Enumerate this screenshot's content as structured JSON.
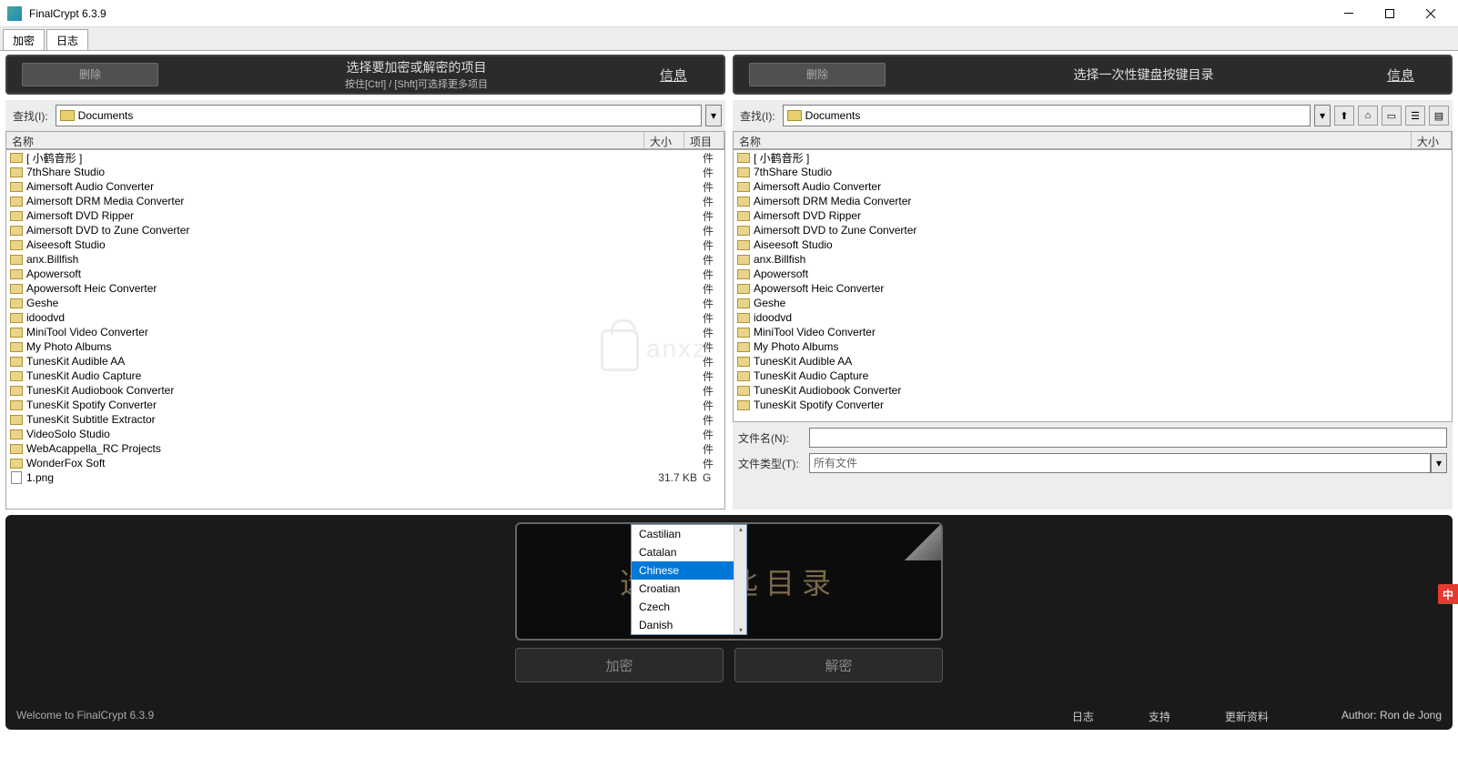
{
  "window": {
    "title": "FinalCrypt 6.3.9"
  },
  "tabs": {
    "t1": "加密",
    "t2": "日志"
  },
  "panelLeft": {
    "delete": "删除",
    "title": "选择要加密或解密的项目",
    "sub": "按住[Ctrl] / [Shft]可选择更多项目",
    "info": "信息"
  },
  "panelRight": {
    "delete": "删除",
    "title": "选择一次性键盘按键目录",
    "info": "信息"
  },
  "lookup": {
    "label": "查找(I):",
    "value": "Documents"
  },
  "cols": {
    "name": "名称",
    "size": "大小",
    "type": "项目类"
  },
  "filesLeft": [
    {
      "n": "[ 小鹤音形 ]",
      "t": "件",
      "f": 1
    },
    {
      "n": "7thShare Studio",
      "t": "件",
      "f": 1
    },
    {
      "n": "Aimersoft Audio Converter",
      "t": "件",
      "f": 1
    },
    {
      "n": "Aimersoft DRM Media Converter",
      "t": "件",
      "f": 1
    },
    {
      "n": "Aimersoft DVD Ripper",
      "t": "件",
      "f": 1
    },
    {
      "n": "Aimersoft DVD to Zune Converter",
      "t": "件",
      "f": 1
    },
    {
      "n": "Aiseesoft Studio",
      "t": "件",
      "f": 1
    },
    {
      "n": "anx.Billfish",
      "t": "件",
      "f": 1
    },
    {
      "n": "Apowersoft",
      "t": "件",
      "f": 1
    },
    {
      "n": "Apowersoft Heic Converter",
      "t": "件",
      "f": 1
    },
    {
      "n": "Geshe",
      "t": "件",
      "f": 1
    },
    {
      "n": "idoodvd",
      "t": "件",
      "f": 1
    },
    {
      "n": "MiniTool Video Converter",
      "t": "件",
      "f": 1
    },
    {
      "n": "My Photo Albums",
      "t": "件",
      "f": 1
    },
    {
      "n": "TunesKit Audible AA",
      "t": "件",
      "f": 1
    },
    {
      "n": "TunesKit Audio Capture",
      "t": "件",
      "f": 1
    },
    {
      "n": "TunesKit Audiobook Converter",
      "t": "件",
      "f": 1
    },
    {
      "n": "TunesKit Spotify Converter",
      "t": "件",
      "f": 1
    },
    {
      "n": "TunesKit Subtitle Extractor",
      "t": "件",
      "f": 1
    },
    {
      "n": "VideoSolo Studio",
      "t": "件",
      "f": 1
    },
    {
      "n": "WebAcappella_RC Projects",
      "t": "件",
      "f": 1
    },
    {
      "n": "WonderFox Soft",
      "t": "件",
      "f": 1
    },
    {
      "n": "1.png",
      "s": "31.7 KB",
      "t": "G",
      "f": 0
    }
  ],
  "filesRight": [
    {
      "n": "[ 小鹤音形 ]",
      "f": 1
    },
    {
      "n": "7thShare Studio",
      "f": 1
    },
    {
      "n": "Aimersoft Audio Converter",
      "f": 1
    },
    {
      "n": "Aimersoft DRM Media Converter",
      "f": 1
    },
    {
      "n": "Aimersoft DVD Ripper",
      "f": 1
    },
    {
      "n": "Aimersoft DVD to Zune Converter",
      "f": 1
    },
    {
      "n": "Aiseesoft Studio",
      "f": 1
    },
    {
      "n": "anx.Billfish",
      "f": 1
    },
    {
      "n": "Apowersoft",
      "f": 1
    },
    {
      "n": "Apowersoft Heic Converter",
      "f": 1
    },
    {
      "n": "Geshe",
      "f": 1
    },
    {
      "n": "idoodvd",
      "f": 1
    },
    {
      "n": "MiniTool Video Converter",
      "f": 1
    },
    {
      "n": "My Photo Albums",
      "f": 1
    },
    {
      "n": "TunesKit Audible AA",
      "f": 1
    },
    {
      "n": "TunesKit Audio Capture",
      "f": 1
    },
    {
      "n": "TunesKit Audiobook Converter",
      "f": 1
    },
    {
      "n": "TunesKit Spotify Converter",
      "f": 1
    }
  ],
  "fileInput": {
    "nameLabel": "文件名(N):",
    "typeLabel": "文件类型(T):",
    "typeValue": "所有文件"
  },
  "bigText": "选择钥匙目录",
  "actions": {
    "encrypt": "加密",
    "decrypt": "解密"
  },
  "status": {
    "welcome": "Welcome to FinalCrypt 6.3.9",
    "log": "日志",
    "support": "支持",
    "update": "更新资料",
    "author": "Author: Ron de Jong"
  },
  "langs": [
    "Castilian",
    "Catalan",
    "Chinese",
    "Croatian",
    "Czech",
    "Danish"
  ],
  "ime": "中"
}
